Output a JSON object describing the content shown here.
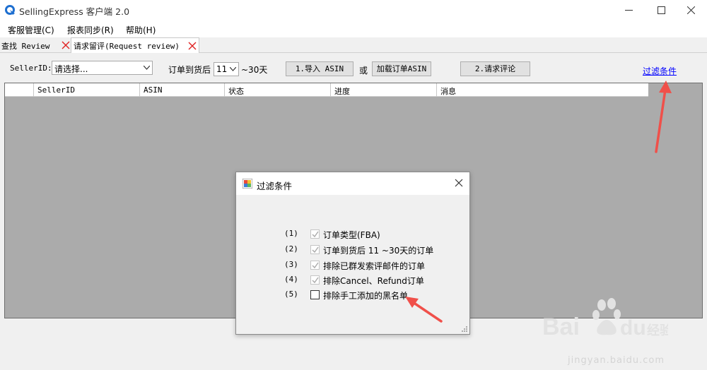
{
  "window": {
    "title": "SellingExpress  客户端 2.0"
  },
  "menu": [
    {
      "label": "客服管理(C)"
    },
    {
      "label": "报表同步(R)"
    },
    {
      "label": "帮助(H)"
    }
  ],
  "tabs": [
    {
      "label": "查找 Review"
    },
    {
      "label": "请求留评(Request review)"
    }
  ],
  "toolbar": {
    "seller_label": "SellerID:",
    "seller_value": "请选择...",
    "days_label": "订单到货后",
    "days_value": "11",
    "days_suffix": "~30天",
    "import_button": "1.导入 ASIN",
    "or_label": "或",
    "load_button": "加载订单ASIN",
    "request_button": "2.请求评论",
    "filter_link": "过滤条件"
  },
  "grid": {
    "columns": [
      "SellerID",
      "ASIN",
      "状态",
      "进度",
      "消息"
    ]
  },
  "dialog": {
    "title": "过滤条件",
    "options": [
      {
        "num": "(1)",
        "label": "订单类型(FBA)",
        "checked": true
      },
      {
        "num": "(2)",
        "label": "订单到货后 11 ~30天的订单",
        "checked": true
      },
      {
        "num": "(3)",
        "label": "排除已群发索评邮件的订单",
        "checked": true
      },
      {
        "num": "(4)",
        "label": "排除Cancel、Refund订单",
        "checked": true
      },
      {
        "num": "(5)",
        "label": "排除手工添加的黑名单",
        "checked": false
      }
    ]
  },
  "colors": {
    "annotation_arrow": "#f0504a",
    "link": "#0000ff",
    "grid_bg": "#ababab"
  },
  "watermark": {
    "text": "jingyan.baidu.com"
  }
}
